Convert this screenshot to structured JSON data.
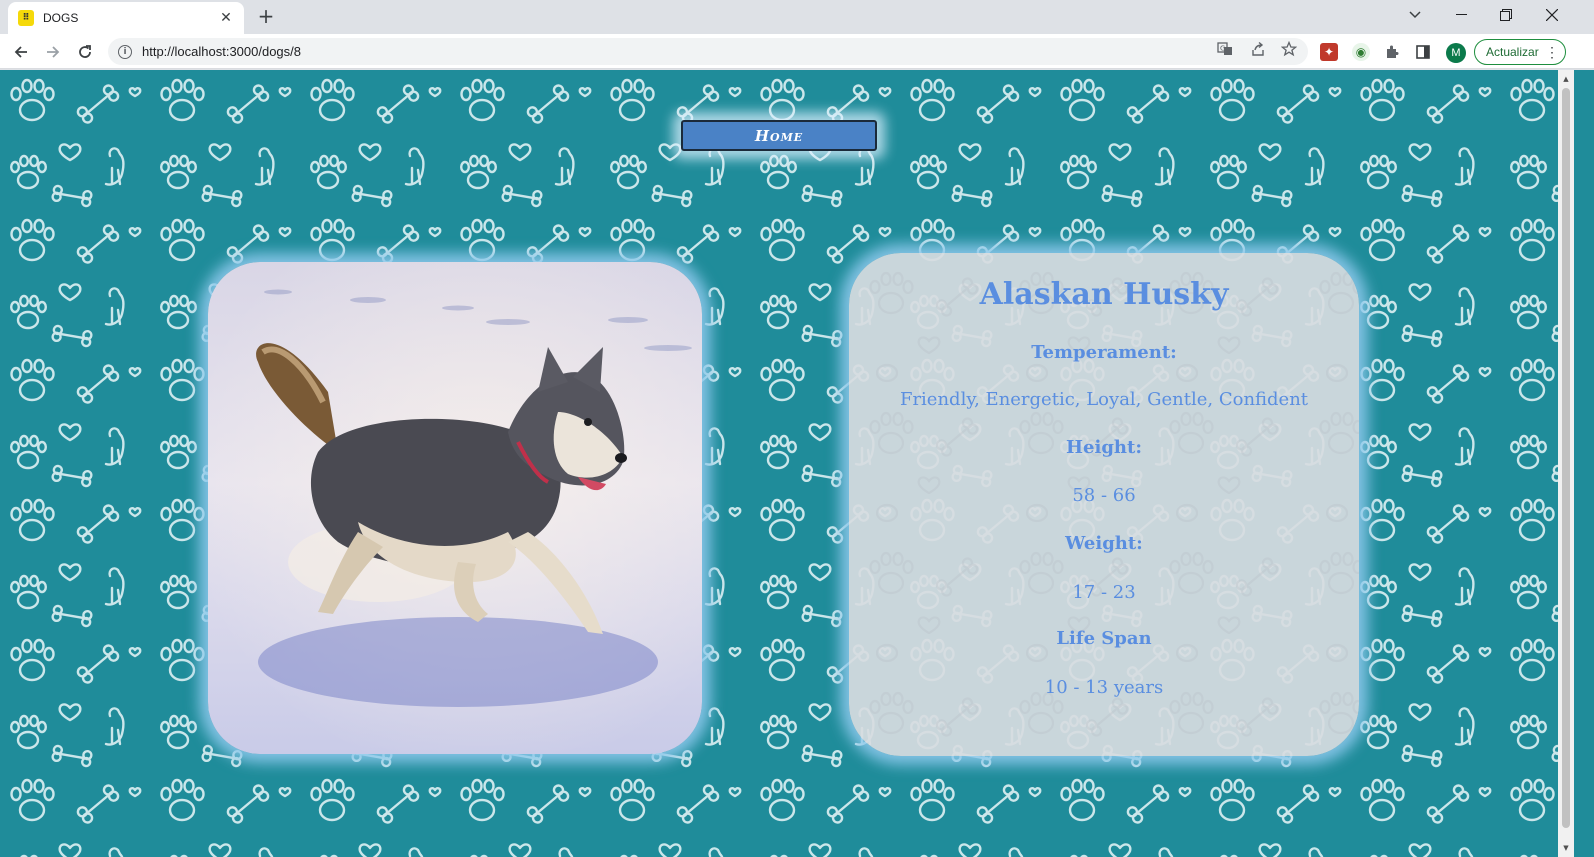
{
  "browser": {
    "tab_title": "DOGS",
    "tab_favicon": "paw-favicon",
    "url": "http://localhost:3000/dogs/8",
    "update_label": "Actualizar",
    "profile_initial": "M"
  },
  "page": {
    "home_label": "Home",
    "dog": {
      "name": "Alaskan Husky",
      "temperament_label": "Temperament:",
      "temperament": "Friendly, Energetic, Loyal, Gentle, Confident",
      "height_label": "Height:",
      "height": "58 - 66",
      "weight_label": "Weight:",
      "weight": "17 - 23",
      "life_span_label": "Life Span",
      "life_span": "10 - 13 years"
    }
  },
  "colors": {
    "background": "#1f8c9a",
    "accent_text": "#5a8ee0",
    "home_button": "#4a82c6"
  }
}
